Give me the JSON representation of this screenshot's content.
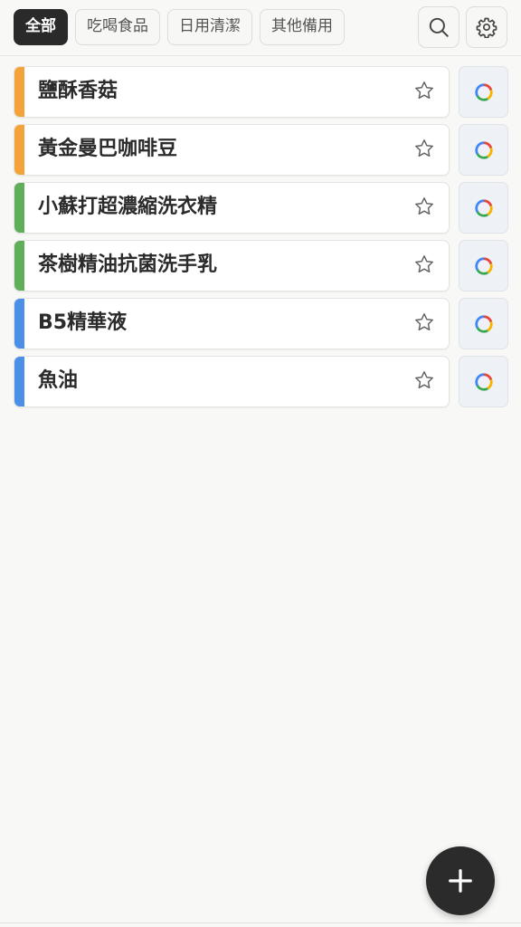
{
  "tabs": [
    {
      "label": "全部",
      "active": true
    },
    {
      "label": "吃喝食品",
      "active": false
    },
    {
      "label": "日用清潔",
      "active": false
    },
    {
      "label": "其他備用",
      "active": false
    }
  ],
  "header_buttons": {
    "search_icon": "search-icon",
    "settings_icon": "gear-icon"
  },
  "colors": {
    "food": "#f3a33a",
    "cleaning": "#5fae5a",
    "other": "#4b8fe6",
    "dark": "#2a2a2a"
  },
  "items": [
    {
      "name": "鹽酥香菇",
      "category": "food"
    },
    {
      "name": "黃金曼巴咖啡豆",
      "category": "food"
    },
    {
      "name": "小蘇打超濃縮洗衣精",
      "category": "cleaning"
    },
    {
      "name": "茶樹精油抗菌洗手乳",
      "category": "cleaning"
    },
    {
      "name": "B5精華液",
      "category": "other"
    },
    {
      "name": "魚油",
      "category": "other"
    }
  ],
  "item_icons": {
    "favorite": "star-outline-icon",
    "action": "multicolor-ring-icon"
  },
  "fab_icon": "plus-icon"
}
